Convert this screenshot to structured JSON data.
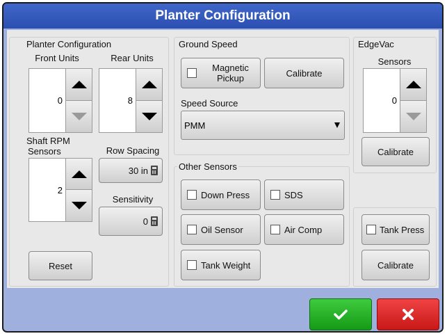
{
  "title": "Planter Configuration",
  "planter": {
    "group_label": "Planter Configuration",
    "front_units_label": "Front Units",
    "front_units_value": "0",
    "rear_units_label": "Rear Units",
    "rear_units_value": "8",
    "shaft_rpm_label_line1": "Shaft RPM",
    "shaft_rpm_label_line2": "Sensors",
    "shaft_rpm_value": "2",
    "row_spacing_label": "Row Spacing",
    "row_spacing_value": "30 in",
    "sensitivity_label": "Sensitivity",
    "sensitivity_value": "0",
    "reset_label": "Reset"
  },
  "ground_speed": {
    "group_label": "Ground Speed",
    "magnetic_pickup_line1": "Magnetic",
    "magnetic_pickup_line2": "Pickup",
    "magnetic_pickup_checked": false,
    "calibrate_label": "Calibrate",
    "speed_source_label": "Speed Source",
    "speed_source_value": "PMM"
  },
  "other_sensors": {
    "group_label": "Other Sensors",
    "down_press": "Down Press",
    "sds": "SDS",
    "oil_sensor": "Oil Sensor",
    "air_comp": "Air Comp",
    "tank_weight": "Tank Weight"
  },
  "edgevac": {
    "group_label": "EdgeVac",
    "sensors_label": "Sensors",
    "sensors_value": "0",
    "calibrate_label": "Calibrate"
  },
  "tank": {
    "tank_press": "Tank Press",
    "calibrate_label": "Calibrate"
  },
  "colors": {
    "title_bar": "#2f57b9",
    "footer": "#9fb0df",
    "ok": "#22aa22",
    "cancel": "#dd2222"
  }
}
